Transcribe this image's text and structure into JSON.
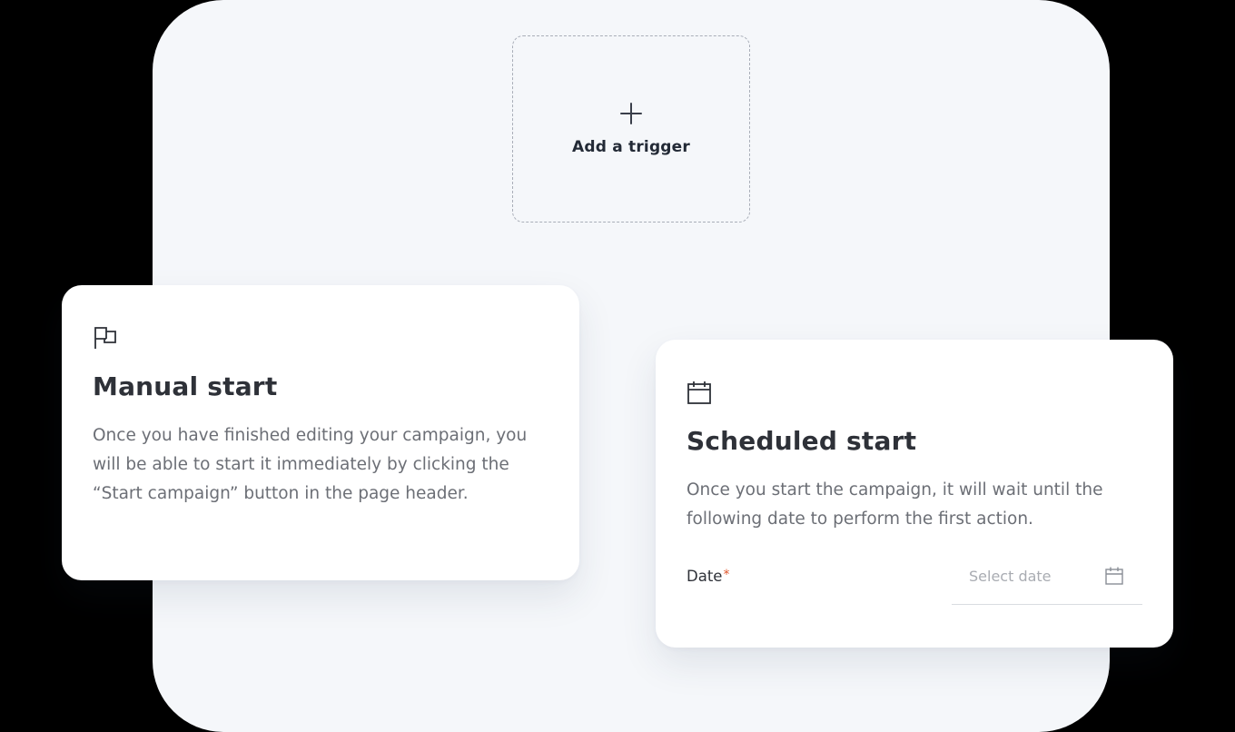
{
  "trigger": {
    "add_label": "Add a trigger",
    "icon": "plus-icon"
  },
  "manual_start": {
    "icon": "flag-icon",
    "title": "Manual start",
    "description": "Once you have finished editing your campaign, you will be able to start it immediately by clicking the “Start campaign” button in the page header."
  },
  "scheduled_start": {
    "icon": "calendar-icon",
    "title": "Scheduled start",
    "description": "Once you start the campaign, it will wait until the following date to perform the first action.",
    "date_label": "Date",
    "required_mark": "*",
    "date_placeholder": "Select date",
    "date_icon": "calendar-icon"
  },
  "colors": {
    "page_background": "#000000",
    "canvas_background": "#f5f7fa",
    "card_background": "#ffffff",
    "title_text": "#2e3138",
    "body_text": "#6c6f76",
    "placeholder_text": "#a9acb2",
    "required_accent": "#e0572c",
    "dashed_border": "#a9aeb8"
  }
}
